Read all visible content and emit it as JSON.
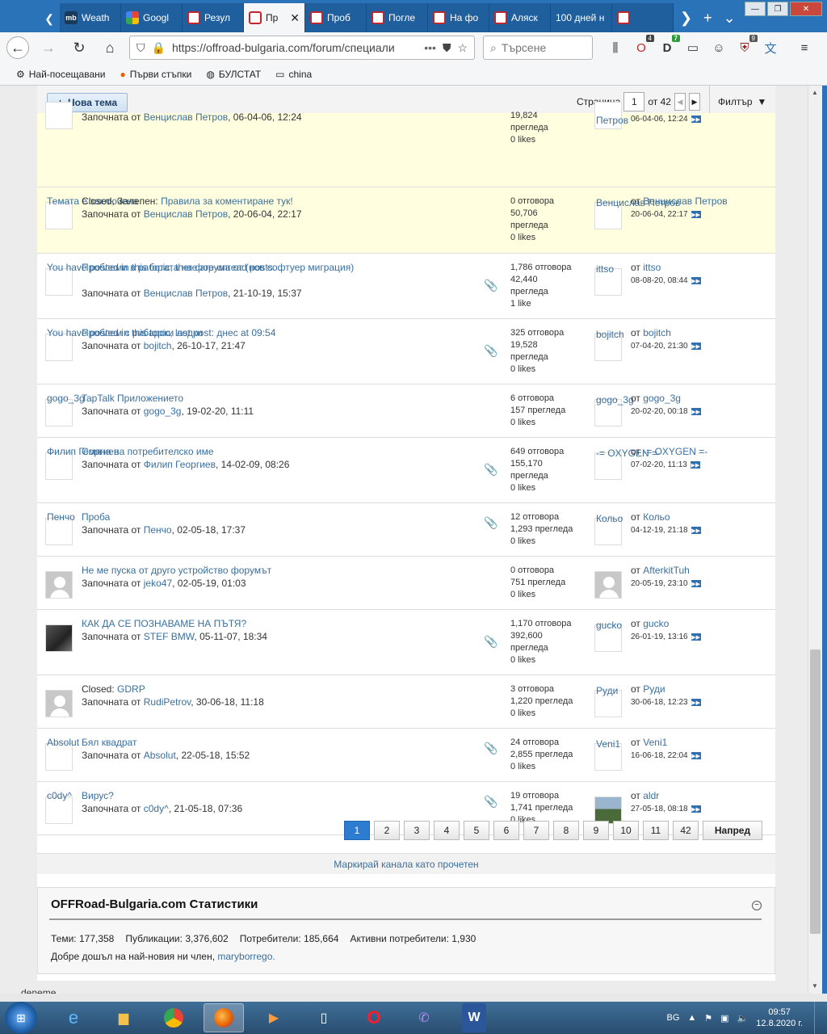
{
  "browser": {
    "tabs": [
      {
        "label": "Weath",
        "favicon": "mb"
      },
      {
        "label": "Googl",
        "favicon": "google"
      },
      {
        "label": "Резул",
        "favicon": "offroad"
      },
      {
        "label": "Пр",
        "favicon": "offroad",
        "active": true
      },
      {
        "label": "Проб",
        "favicon": "offroad"
      },
      {
        "label": "Погле",
        "favicon": "offroad"
      },
      {
        "label": "На фо",
        "favicon": "offroad"
      },
      {
        "label": "Аляск",
        "favicon": "offroad"
      },
      {
        "label": "100 дней н",
        "favicon": ""
      },
      {
        "label": "",
        "favicon": "offroad"
      }
    ],
    "url": "https://offroad-bulgaria.com/forum/специали",
    "search_placeholder": "Търсене",
    "badges": {
      "b1": "4",
      "b2": "7",
      "b3": "9"
    },
    "bookmarks": [
      "Най-посещавани",
      "Първи стъпки",
      "БУЛСТАТ",
      "china"
    ]
  },
  "toolbar": {
    "new_topic": "Нова тема",
    "page_label": "Страница",
    "page_value": "1",
    "of_label": "от 42",
    "filter": "Филтър"
  },
  "topics": [
    {
      "alt": "",
      "prefix": "",
      "title": "",
      "started_by": "Венцислав Петров",
      "started_at": ", 06-04-06, 12:24",
      "stats": [
        "19,824",
        "прегледа",
        "0 likes"
      ],
      "lp_alt": "Петров",
      "lp_by": "",
      "lp_date": "06-04-06, 12:24",
      "sticky": true,
      "clip": false
    },
    {
      "alt": "Темата е заключена",
      "prefix": "Closed, Залепен:",
      "title": "Правила за коментиране тук!",
      "started_by": "Венцислав Петров",
      "started_at": ", 20-06-04, 22:17",
      "stats": [
        "0 отговора",
        "50,706",
        "прегледа",
        "0 likes"
      ],
      "lp_alt": "Венцислав Петров",
      "lp_by": "Венцислав Петров",
      "lp_date": "20-06-04, 22:17",
      "sticky": true,
      "clip": false
    },
    {
      "alt": "You have posted in this topic, there are unread posts.",
      "prefix": "",
      "title": "Проблеми в работата на форума от (нов софтуер миграция)",
      "started_by": "Венцислав Петров",
      "started_at": ", 21-10-19, 15:37",
      "stats": [
        "1,786 отговора",
        "42,440",
        "прегледа",
        "1 like"
      ],
      "lp_alt": "ittso",
      "lp_by": "ittso",
      "lp_date": "08-08-20, 08:44",
      "sticky": false,
      "clip": true
    },
    {
      "alt": "You have posted in this topic, last post: днес at 09:54",
      "prefix": "",
      "title": "Проблем с рибарски лодки",
      "started_by": "bojitch",
      "started_at": ", 26-10-17, 21:47",
      "stats": [
        "325 отговора",
        "19,528",
        "прегледа",
        "0 likes"
      ],
      "lp_alt": "bojitch",
      "lp_by": "bojitch",
      "lp_date": "07-04-20, 21:30",
      "sticky": false,
      "clip": true
    },
    {
      "alt": "gogo_3g",
      "prefix": "",
      "title": "TapTalk Приложението",
      "started_by": "gogo_3g",
      "started_at": ", 19-02-20, 11:11",
      "stats": [
        "6 отговора",
        "157 прегледа",
        "0 likes"
      ],
      "lp_alt": "gogo_3g",
      "lp_by": "gogo_3g",
      "lp_date": "20-02-20, 00:18",
      "sticky": false,
      "clip": false
    },
    {
      "alt": "Филип Георгиев",
      "prefix": "",
      "title": "Смяна на потребителско име",
      "started_by": "Филип Георгиев",
      "started_at": ", 14-02-09, 08:26",
      "stats": [
        "649 отговора",
        "155,170",
        "прегледа",
        "0 likes"
      ],
      "lp_alt": "-= OXYGEN =-",
      "lp_by": "-= OXYGEN =-",
      "lp_date": "07-02-20, 11:13",
      "sticky": false,
      "clip": true
    },
    {
      "alt": "Пенчо",
      "prefix": "",
      "title": "Проба",
      "started_by": "Пенчо",
      "started_at": ", 02-05-18, 17:37",
      "stats": [
        "12 отговора",
        "1,293 прегледа",
        "0 likes"
      ],
      "lp_alt": "Кольо",
      "lp_by": "Кольо",
      "lp_date": "04-12-19, 21:18",
      "sticky": false,
      "clip": true
    },
    {
      "alt": "",
      "prefix": "",
      "title": "Не ме пуска от друго устройство форумът",
      "started_by": "jeko47",
      "started_at": ", 02-05-19, 01:03",
      "stats": [
        "0 отговора",
        "751 прегледа",
        "0 likes"
      ],
      "lp_alt": "",
      "lp_by": "AfterkitTuh",
      "lp_date": "20-05-19, 23:10",
      "sticky": false,
      "clip": false,
      "avatar": "gen",
      "lp_avatar": "gen"
    },
    {
      "alt": "",
      "prefix": "",
      "title": "КАК ДА СЕ ПОЗНАВАМЕ НА ПЪТЯ?",
      "started_by": "STEF BMW",
      "started_at": ", 05-11-07, 18:34",
      "stats": [
        "1,170 отговора",
        "392,600",
        "прегледа",
        "0 likes"
      ],
      "lp_alt": "gucko",
      "lp_by": "gucko",
      "lp_date": "26-01-19, 13:16",
      "sticky": false,
      "clip": true,
      "avatar": "photo"
    },
    {
      "alt": "",
      "prefix": "Closed:",
      "title": "GDRP",
      "started_by": "RudiPetrov",
      "started_at": ", 30-06-18, 11:18",
      "stats": [
        "3 отговора",
        "1,220 прегледа",
        "0 likes"
      ],
      "lp_alt": "Руди",
      "lp_by": "Руди",
      "lp_date": "30-06-18, 12:23",
      "sticky": false,
      "clip": false,
      "avatar": "gen"
    },
    {
      "alt": "Absolut",
      "prefix": "",
      "title": "Бял квадрат",
      "started_by": "Absolut",
      "started_at": ", 22-05-18, 15:52",
      "stats": [
        "24 отговора",
        "2,855 прегледа",
        "0 likes"
      ],
      "lp_alt": "Veni1",
      "lp_by": "Veni1",
      "lp_date": "16-06-18, 22:04",
      "sticky": false,
      "clip": true
    },
    {
      "alt": "c0dy^",
      "prefix": "",
      "title": "Вирус?",
      "started_by": "c0dy^",
      "started_at": ", 21-05-18, 07:36",
      "stats": [
        "19 отговора",
        "1,741 прегледа",
        "0 likes"
      ],
      "lp_alt": "",
      "lp_by": "aldr",
      "lp_date": "27-05-18, 08:18",
      "sticky": false,
      "clip": true,
      "lp_avatar": "photo2"
    }
  ],
  "started_label": "Започната от",
  "by_label": "от",
  "pagination": [
    "1",
    "2",
    "3",
    "4",
    "5",
    "6",
    "7",
    "8",
    "9",
    "10",
    "11",
    "42"
  ],
  "next_label": "Напред",
  "mark_read": "Маркирай канала като прочетен",
  "stats": {
    "title": "OFFRoad-Bulgaria.com Статистики",
    "threads_label": "Теми:",
    "threads": "177,358",
    "posts_label": "Публикации:",
    "posts": "3,376,602",
    "members_label": "Потребители:",
    "members": "185,664",
    "active_label": "Активни потребители:",
    "active": "1,930",
    "welcome": "Добре дошъл на най-новия ни член,",
    "newest": "maryborrego."
  },
  "footer_text": "deneme",
  "taskbar": {
    "lang": "BG",
    "time": "09:57",
    "date": "12.8.2020 г."
  }
}
